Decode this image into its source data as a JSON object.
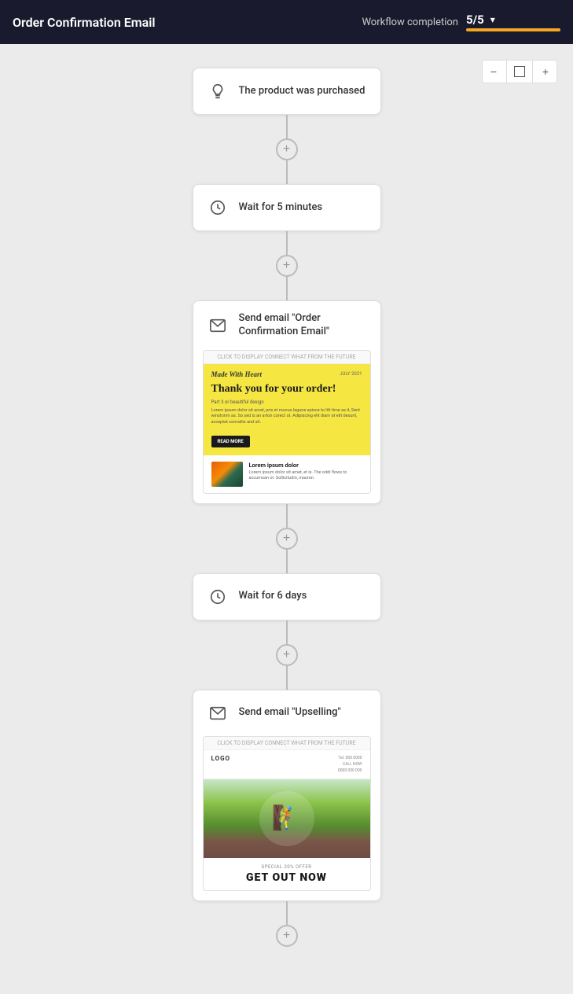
{
  "header": {
    "title": "Order Confirmation Email",
    "workflow_completion_label": "Workflow completion",
    "workflow_completion_value": "5/5",
    "completion_percent": 100
  },
  "zoom_controls": {
    "minus_label": "−",
    "plus_label": "+"
  },
  "nodes": {
    "trigger": {
      "label": "The product was purchased",
      "icon": "lightbulb-icon"
    },
    "wait_minutes": {
      "label": "Wait for 5 minutes",
      "icon": "clock-icon"
    },
    "send_email_1": {
      "label": "Send email \"Order Confirmation Email\"",
      "icon": "envelope-icon"
    },
    "wait_days": {
      "label": "Wait for 6 days",
      "icon": "clock-icon"
    },
    "send_email_2": {
      "label": "Send email \"Upselling\"",
      "icon": "envelope-icon"
    }
  },
  "email_preview_order": {
    "topbar_text": "CLICK TO DISPLAY CONNECT WHAT FROM THE FUTURE",
    "brand": "Made With Heart",
    "date": "JULY 2021",
    "thank_you": "Thank you for your order!",
    "sub": "Part 3 or beautiful design",
    "lorem": "Lorem ipsum dolor sit amet, prix et munus lagune apisce to litt time as it, Sent winstonm as. So sed is an arton corect ut. Adipiscing elit diam at elit desunt, acceptat convallis and sit.",
    "cta": "READ MORE",
    "product_title": "Lorem ipsum dolor",
    "product_desc": "Lorem ipsum dolor sit amet, et is. The oddi flows to accumsan or. Sollicitudin, mauran."
  },
  "email_preview_upsell": {
    "topbar_text": "CLICK TO DISPLAY CONNECT WHAT FROM THE FUTURE",
    "logo": "LOGO",
    "contact_line1": "Tel. 000 0000",
    "contact_line2": "CALL NOW",
    "contact_line3": "0000 000 000",
    "offer_text": "SPECIAL 20% OFFER",
    "get_out": "GET OUT NOW"
  },
  "add_buttons": {
    "label": "+"
  }
}
